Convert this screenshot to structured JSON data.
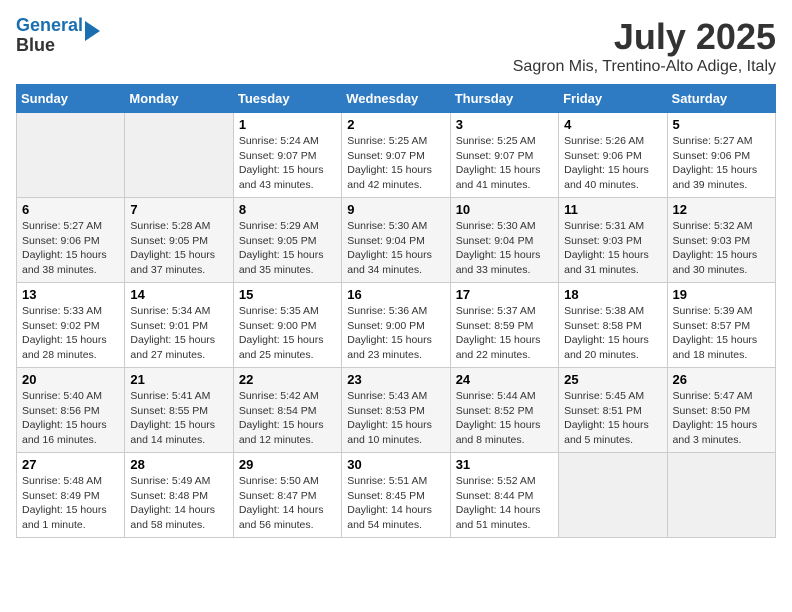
{
  "header": {
    "logo_line1": "General",
    "logo_line2": "Blue",
    "month": "July 2025",
    "location": "Sagron Mis, Trentino-Alto Adige, Italy"
  },
  "weekdays": [
    "Sunday",
    "Monday",
    "Tuesday",
    "Wednesday",
    "Thursday",
    "Friday",
    "Saturday"
  ],
  "weeks": [
    [
      {
        "day": "",
        "info": ""
      },
      {
        "day": "",
        "info": ""
      },
      {
        "day": "1",
        "info": "Sunrise: 5:24 AM\nSunset: 9:07 PM\nDaylight: 15 hours and 43 minutes."
      },
      {
        "day": "2",
        "info": "Sunrise: 5:25 AM\nSunset: 9:07 PM\nDaylight: 15 hours and 42 minutes."
      },
      {
        "day": "3",
        "info": "Sunrise: 5:25 AM\nSunset: 9:07 PM\nDaylight: 15 hours and 41 minutes."
      },
      {
        "day": "4",
        "info": "Sunrise: 5:26 AM\nSunset: 9:06 PM\nDaylight: 15 hours and 40 minutes."
      },
      {
        "day": "5",
        "info": "Sunrise: 5:27 AM\nSunset: 9:06 PM\nDaylight: 15 hours and 39 minutes."
      }
    ],
    [
      {
        "day": "6",
        "info": "Sunrise: 5:27 AM\nSunset: 9:06 PM\nDaylight: 15 hours and 38 minutes."
      },
      {
        "day": "7",
        "info": "Sunrise: 5:28 AM\nSunset: 9:05 PM\nDaylight: 15 hours and 37 minutes."
      },
      {
        "day": "8",
        "info": "Sunrise: 5:29 AM\nSunset: 9:05 PM\nDaylight: 15 hours and 35 minutes."
      },
      {
        "day": "9",
        "info": "Sunrise: 5:30 AM\nSunset: 9:04 PM\nDaylight: 15 hours and 34 minutes."
      },
      {
        "day": "10",
        "info": "Sunrise: 5:30 AM\nSunset: 9:04 PM\nDaylight: 15 hours and 33 minutes."
      },
      {
        "day": "11",
        "info": "Sunrise: 5:31 AM\nSunset: 9:03 PM\nDaylight: 15 hours and 31 minutes."
      },
      {
        "day": "12",
        "info": "Sunrise: 5:32 AM\nSunset: 9:03 PM\nDaylight: 15 hours and 30 minutes."
      }
    ],
    [
      {
        "day": "13",
        "info": "Sunrise: 5:33 AM\nSunset: 9:02 PM\nDaylight: 15 hours and 28 minutes."
      },
      {
        "day": "14",
        "info": "Sunrise: 5:34 AM\nSunset: 9:01 PM\nDaylight: 15 hours and 27 minutes."
      },
      {
        "day": "15",
        "info": "Sunrise: 5:35 AM\nSunset: 9:00 PM\nDaylight: 15 hours and 25 minutes."
      },
      {
        "day": "16",
        "info": "Sunrise: 5:36 AM\nSunset: 9:00 PM\nDaylight: 15 hours and 23 minutes."
      },
      {
        "day": "17",
        "info": "Sunrise: 5:37 AM\nSunset: 8:59 PM\nDaylight: 15 hours and 22 minutes."
      },
      {
        "day": "18",
        "info": "Sunrise: 5:38 AM\nSunset: 8:58 PM\nDaylight: 15 hours and 20 minutes."
      },
      {
        "day": "19",
        "info": "Sunrise: 5:39 AM\nSunset: 8:57 PM\nDaylight: 15 hours and 18 minutes."
      }
    ],
    [
      {
        "day": "20",
        "info": "Sunrise: 5:40 AM\nSunset: 8:56 PM\nDaylight: 15 hours and 16 minutes."
      },
      {
        "day": "21",
        "info": "Sunrise: 5:41 AM\nSunset: 8:55 PM\nDaylight: 15 hours and 14 minutes."
      },
      {
        "day": "22",
        "info": "Sunrise: 5:42 AM\nSunset: 8:54 PM\nDaylight: 15 hours and 12 minutes."
      },
      {
        "day": "23",
        "info": "Sunrise: 5:43 AM\nSunset: 8:53 PM\nDaylight: 15 hours and 10 minutes."
      },
      {
        "day": "24",
        "info": "Sunrise: 5:44 AM\nSunset: 8:52 PM\nDaylight: 15 hours and 8 minutes."
      },
      {
        "day": "25",
        "info": "Sunrise: 5:45 AM\nSunset: 8:51 PM\nDaylight: 15 hours and 5 minutes."
      },
      {
        "day": "26",
        "info": "Sunrise: 5:47 AM\nSunset: 8:50 PM\nDaylight: 15 hours and 3 minutes."
      }
    ],
    [
      {
        "day": "27",
        "info": "Sunrise: 5:48 AM\nSunset: 8:49 PM\nDaylight: 15 hours and 1 minute."
      },
      {
        "day": "28",
        "info": "Sunrise: 5:49 AM\nSunset: 8:48 PM\nDaylight: 14 hours and 58 minutes."
      },
      {
        "day": "29",
        "info": "Sunrise: 5:50 AM\nSunset: 8:47 PM\nDaylight: 14 hours and 56 minutes."
      },
      {
        "day": "30",
        "info": "Sunrise: 5:51 AM\nSunset: 8:45 PM\nDaylight: 14 hours and 54 minutes."
      },
      {
        "day": "31",
        "info": "Sunrise: 5:52 AM\nSunset: 8:44 PM\nDaylight: 14 hours and 51 minutes."
      },
      {
        "day": "",
        "info": ""
      },
      {
        "day": "",
        "info": ""
      }
    ]
  ]
}
